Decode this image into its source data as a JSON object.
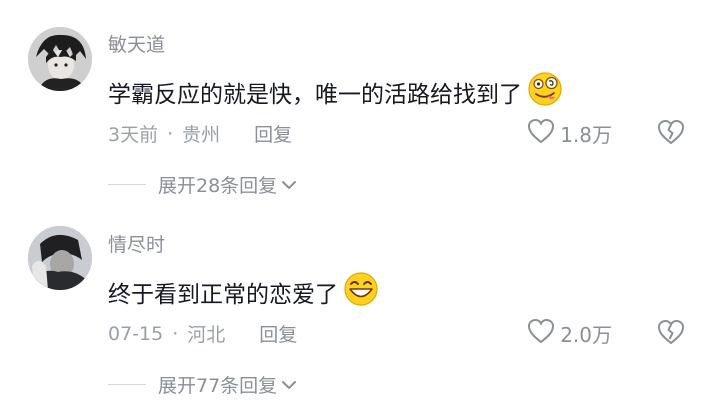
{
  "comments": [
    {
      "username": "敏天道",
      "text": "学霸反应的就是快，唯一的活路给找到了",
      "emoji": "dizzy-face-emoji",
      "date": "3天前",
      "separator": "·",
      "location": "贵州",
      "reply_label": "回复",
      "likes": "1.8万",
      "expand_label": "展开28条回复"
    },
    {
      "username": "情尽时",
      "text": "终于看到正常的恋爱了",
      "emoji": "grinning-face-emoji",
      "date": "07-15",
      "separator": "·",
      "location": "河北",
      "reply_label": "回复",
      "likes": "2.0万",
      "expand_label": "展开77条回复"
    }
  ],
  "colors": {
    "secondary_text": "#8a8f99",
    "primary_text": "#161823",
    "emoji_yellow": "#ffd21f"
  }
}
